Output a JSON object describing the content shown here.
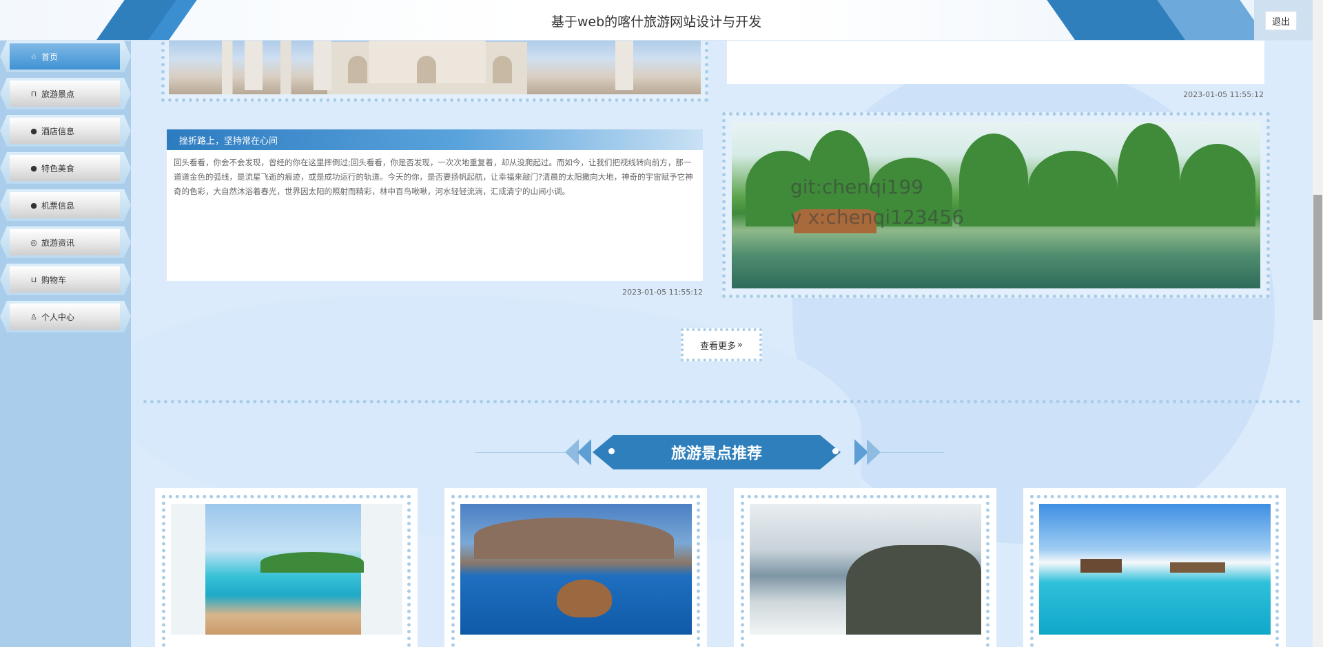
{
  "header": {
    "title": "基于web的喀什旅游网站设计与开发",
    "logout_label": "退出"
  },
  "sidebar": {
    "items": [
      {
        "label": "首页",
        "icon": "star-icon"
      },
      {
        "label": "旅游景点",
        "icon": "bag-icon"
      },
      {
        "label": "酒店信息",
        "icon": "info-circle-icon"
      },
      {
        "label": "特色美食",
        "icon": "question-circle-icon"
      },
      {
        "label": "机票信息",
        "icon": "info-circle-icon"
      },
      {
        "label": "旅游资讯",
        "icon": "dribbble-icon"
      },
      {
        "label": "购物车",
        "icon": "cart-icon"
      },
      {
        "label": "个人中心",
        "icon": "user-icon"
      }
    ]
  },
  "news": {
    "top_right_time": "2023-01-05 11:55:12",
    "card_title": "挫折路上，坚持常在心间",
    "card_body": "回头看看，你会不会发现，曾经的你在这里摔倒过;回头看看，你是否发现，一次次地重复着，却从没爬起过。而如今，让我们把视线转向前方，那一道道金色的弧线，是流星飞逝的痕迹，或是成功运行的轨道。今天的你，是否要扬帆起航，让幸福来敲门?清晨的太阳撒向大地，神奇的宇宙赋予它神奇的色彩，大自然沐浴着春光，世界因太阳的照射而精彩，林中百鸟啾啾，河水轻轻流淌，汇成清宁的山间小调。",
    "card_time": "2023-01-05 11:55:12",
    "watermark_line1": "git:chenqi199",
    "watermark_line2": "v x:chenqi123456",
    "more_label": "查看更多"
  },
  "section": {
    "title": "旅游景点推荐"
  },
  "colors": {
    "accent": "#2f7fbd",
    "dotted_border": "#a9cde8",
    "page_bg": "#dcebfb",
    "sidebar_bg": "#a9cdea"
  }
}
